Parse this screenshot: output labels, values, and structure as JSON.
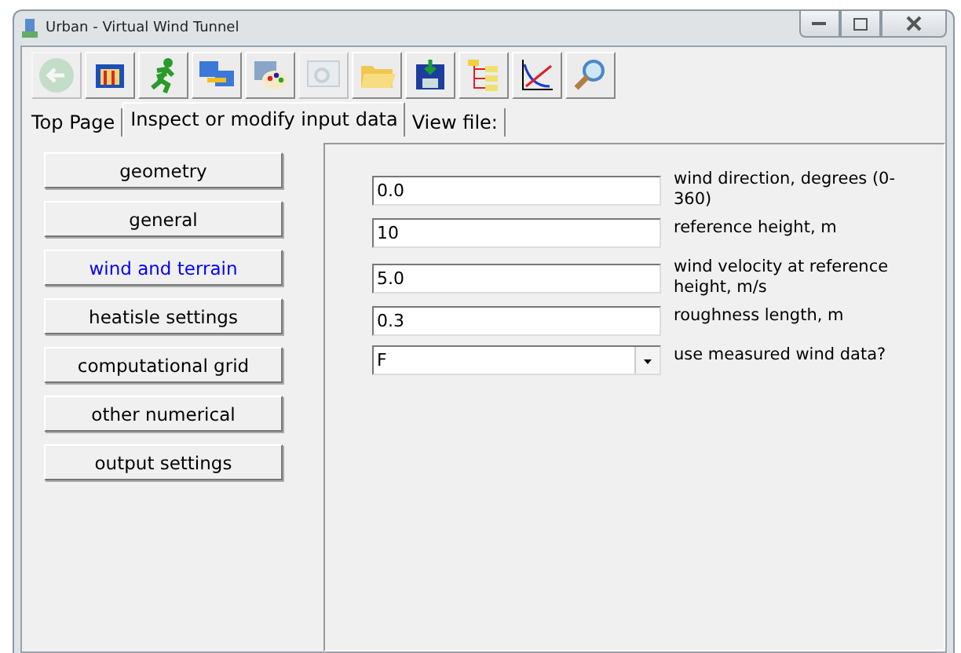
{
  "window": {
    "title": "Urban - Virtual Wind Tunnel"
  },
  "toolbar": [
    {
      "disabled": true
    },
    {
      "disabled": false
    },
    {
      "disabled": false
    },
    {
      "disabled": false
    },
    {
      "disabled": false
    },
    {
      "disabled": true
    },
    {
      "disabled": false
    },
    {
      "disabled": false
    },
    {
      "disabled": false
    },
    {
      "disabled": false
    },
    {
      "disabled": false
    }
  ],
  "tabs": [
    {
      "label": "Top Page",
      "selected": false
    },
    {
      "label": "Inspect or modify input data",
      "selected": true
    },
    {
      "label": "View file:",
      "selected": false
    }
  ],
  "sections": [
    {
      "label": "geometry",
      "selected": false
    },
    {
      "label": "general",
      "selected": false
    },
    {
      "label": "wind and terrain",
      "selected": true
    },
    {
      "label": "heatisle settings",
      "selected": false
    },
    {
      "label": "computational grid",
      "selected": false
    },
    {
      "label": "other numerical",
      "selected": false
    },
    {
      "label": "output settings",
      "selected": false
    }
  ],
  "fields": [
    {
      "kind": "text",
      "value": "0.0",
      "label": "wind direction, degrees (0-360)"
    },
    {
      "kind": "text",
      "value": "10",
      "label": "reference height, m"
    },
    {
      "kind": "text",
      "value": "5.0",
      "label": "wind velocity at reference height, m/s"
    },
    {
      "kind": "text",
      "value": "0.3",
      "label": "roughness length, m"
    },
    {
      "kind": "dropdown",
      "value": "F",
      "label": "use measured wind data?"
    }
  ]
}
